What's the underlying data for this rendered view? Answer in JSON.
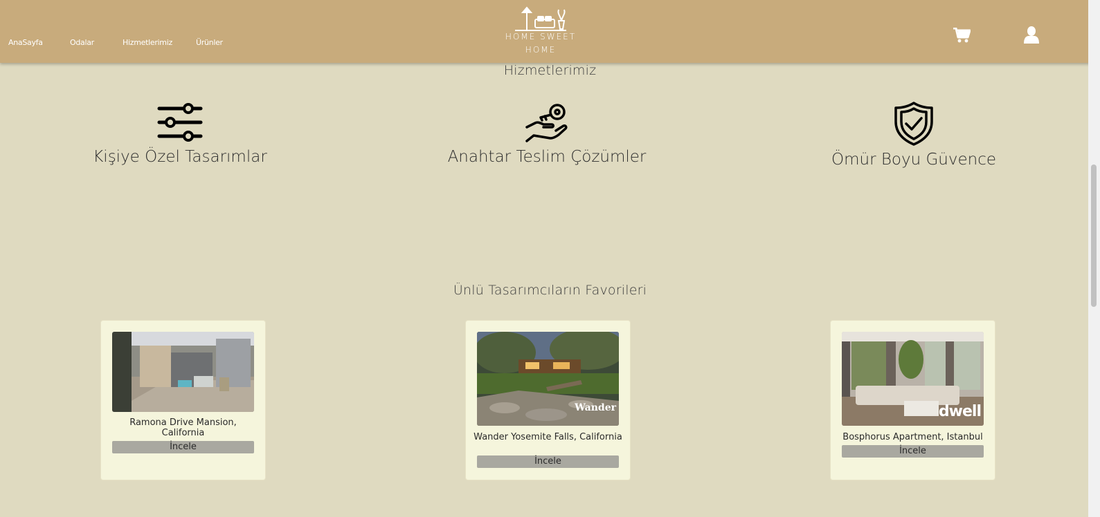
{
  "header": {
    "nav": [
      "AnaSayfa",
      "Odalar",
      "Hizmetlerimiz",
      "Ürünler"
    ],
    "logo_line1": "HOME SWEET",
    "logo_line2": "HOME",
    "cart_icon": "cart-icon",
    "user_icon": "user-icon"
  },
  "services": {
    "title": "Hizmetlerimiz",
    "items": [
      {
        "label": "Kişiye Özel Tasarımlar",
        "icon": "sliders-icon"
      },
      {
        "label": "Anahtar Teslim Çözümler",
        "icon": "key-in-hand-icon"
      },
      {
        "label": "Ömür Boyu Güvence",
        "icon": "shield-check-icon"
      }
    ]
  },
  "favorites": {
    "title": "Ünlü Tasarımcıların Favorileri",
    "cards": [
      {
        "name": "Ramona Drive Mansion, California",
        "button": "İncele"
      },
      {
        "name": "Wander Yosemite Falls, California",
        "button": "İncele",
        "watermark": "Wander"
      },
      {
        "name": "Bosphorus Apartment, Istanbul",
        "button": "İncele",
        "watermark": "dwell"
      }
    ]
  },
  "colors": {
    "header_bg": "#c8ab7c",
    "page_bg": "#dfdac0",
    "card_bg": "#f5f5dc",
    "button_bg": "#a9a8a0"
  }
}
